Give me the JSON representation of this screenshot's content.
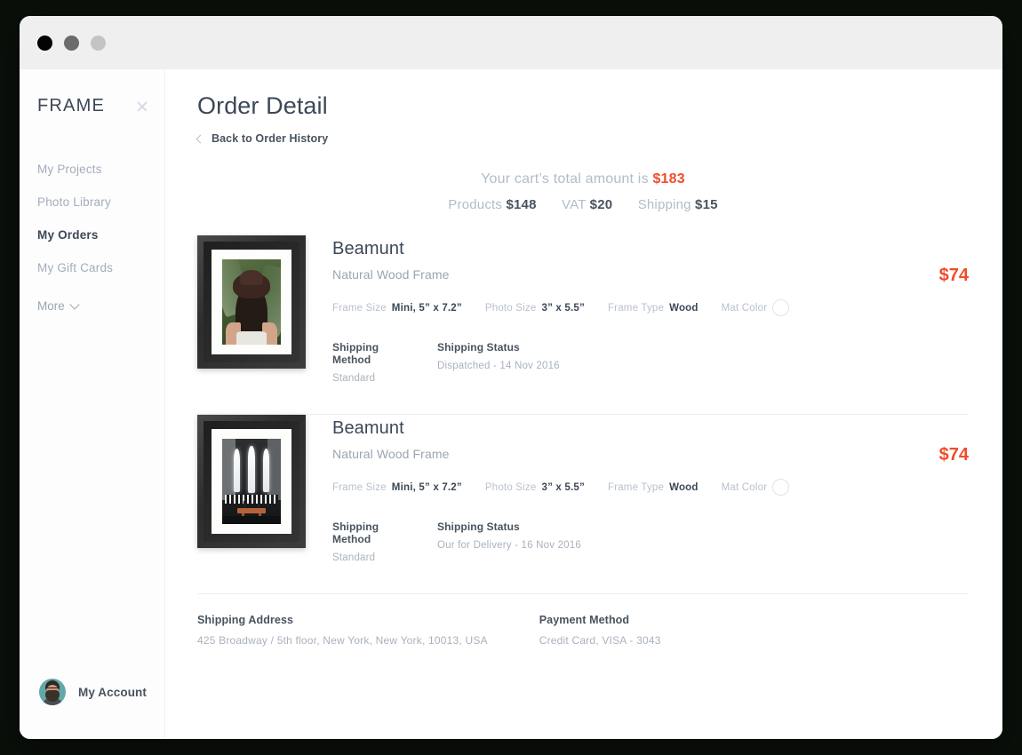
{
  "window": {
    "traffic_lights": [
      "close-dot",
      "minimize-dot",
      "maximize-dot"
    ]
  },
  "sidebar": {
    "brand": "FRAME",
    "close_icon": "close-icon",
    "items": [
      {
        "label": "My Projects",
        "active": false
      },
      {
        "label": "Photo Library",
        "active": false
      },
      {
        "label": "My Orders",
        "active": true
      },
      {
        "label": "My Gift Cards",
        "active": false
      }
    ],
    "more_label": "More",
    "account_label": "My Account"
  },
  "main": {
    "page_title": "Order Detail",
    "back_link": "Back to Order History",
    "totals": {
      "lead_text": "Your cart’s total amount is",
      "total": "$183",
      "breakdown": [
        {
          "label": "Products",
          "value": "$148"
        },
        {
          "label": "VAT",
          "value": "$20"
        },
        {
          "label": "Shipping",
          "value": "$15"
        }
      ]
    },
    "items": [
      {
        "title": "Beamunt",
        "subtitle": "Natural Wood Frame",
        "price": "$74",
        "specs": [
          {
            "label": "Frame Size",
            "value": "Mini, 5” x 7.2”"
          },
          {
            "label": "Photo Size",
            "value": "3” x 5.5”"
          },
          {
            "label": "Frame Type",
            "value": "Wood"
          },
          {
            "label": "Mat Color",
            "value": ""
          }
        ],
        "mat_color": "#ffffff",
        "shipping_method_label": "Shipping Method",
        "shipping_method_value": "Standard",
        "shipping_status_label": "Shipping Status",
        "shipping_status_value": "Dispatched - 14 Nov 2016"
      },
      {
        "title": "Beamunt",
        "subtitle": "Natural Wood Frame",
        "price": "$74",
        "specs": [
          {
            "label": "Frame Size",
            "value": "Mini, 5” x 7.2”"
          },
          {
            "label": "Photo Size",
            "value": "3” x 5.5”"
          },
          {
            "label": "Frame Type",
            "value": "Wood"
          },
          {
            "label": "Mat Color",
            "value": ""
          }
        ],
        "mat_color": "#ffffff",
        "shipping_method_label": "Shipping Method",
        "shipping_method_value": "Standard",
        "shipping_status_label": "Shipping Status",
        "shipping_status_value": "Our for Delivery - 16 Nov 2016"
      }
    ],
    "footer": {
      "shipping_address_label": "Shipping Address",
      "shipping_address_value": "425 Broadway / 5th floor, New York, New York, 10013, USA",
      "payment_method_label": "Payment Method",
      "payment_method_value": "Credit Card, VISA - 3043"
    }
  },
  "colors": {
    "accent": "#ef4d2c",
    "text_dark": "#3c4757",
    "text_muted": "#a9b2bd",
    "divider": "#eceff3"
  }
}
